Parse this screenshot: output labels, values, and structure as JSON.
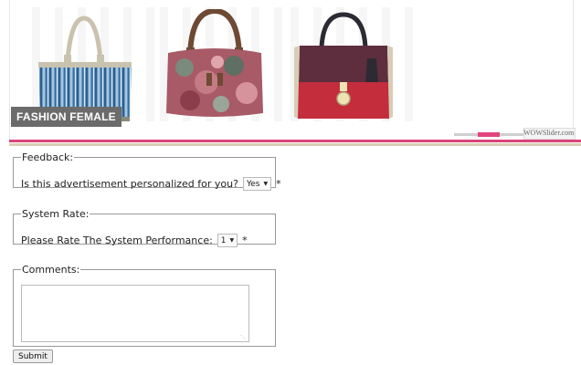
{
  "banner": {
    "caption": "FASHION FEMALE",
    "watermark": "WOWSlider.com",
    "accent_color": "#d9447a",
    "products": [
      {
        "icon": "striped-tote-bag-image"
      },
      {
        "icon": "floral-handbag-image"
      },
      {
        "icon": "burgundy-red-handbag-image"
      }
    ]
  },
  "feedback": {
    "legend": "Feedback:",
    "question": "Is this advertisement personalized for you?",
    "selected": "Yes",
    "required_mark": "*"
  },
  "system_rate": {
    "legend": "System Rate:",
    "question": "Please Rate The System Performance:",
    "selected": "1",
    "required_mark": "*"
  },
  "comments": {
    "legend": "Comments:",
    "value": ""
  },
  "submit_label": "Submit"
}
